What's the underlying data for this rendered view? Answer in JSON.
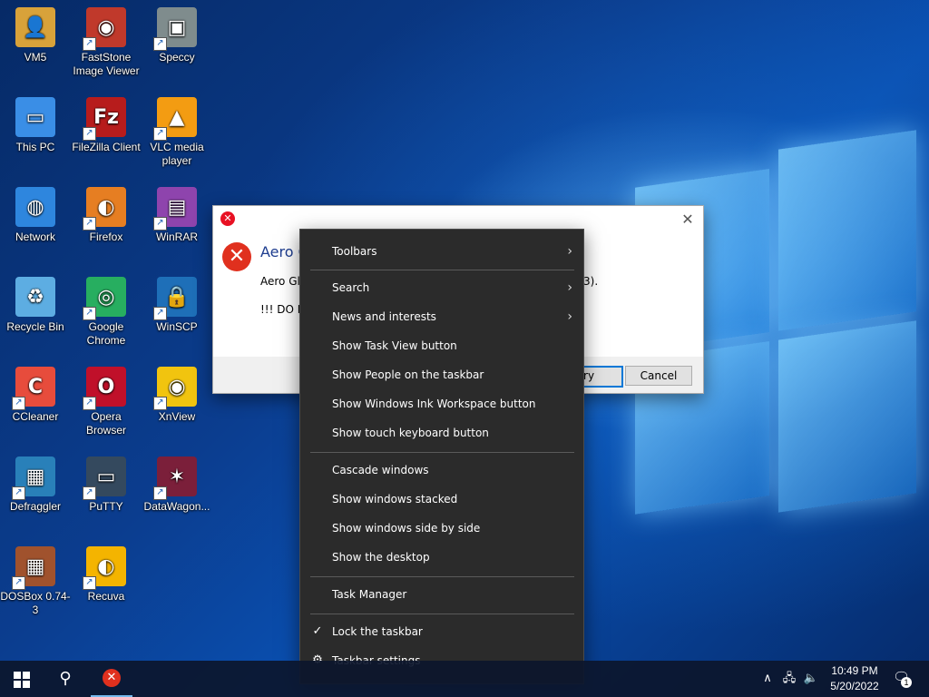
{
  "colors": {
    "menu_bg": "#2b2b2b",
    "taskbar_bg": "#0c162c",
    "error_red": "#e0301e",
    "dialog_heading": "#1e3d8f",
    "accent": "#0078d7"
  },
  "desktop": {
    "icons": [
      {
        "label": "VM5",
        "icon": "user-folder-icon"
      },
      {
        "label": "FastStone Image Viewer",
        "icon": "faststone-eye-icon"
      },
      {
        "label": "Speccy",
        "icon": "speccy-icon"
      },
      {
        "label": "This PC",
        "icon": "computer-monitor-icon"
      },
      {
        "label": "FileZilla Client",
        "icon": "filezilla-icon"
      },
      {
        "label": "VLC media player",
        "icon": "vlc-cone-icon"
      },
      {
        "label": "Network",
        "icon": "network-globe-icon"
      },
      {
        "label": "Firefox",
        "icon": "firefox-icon"
      },
      {
        "label": "WinRAR",
        "icon": "winrar-books-icon"
      },
      {
        "label": "Recycle Bin",
        "icon": "recycle-bin-icon"
      },
      {
        "label": "Google Chrome",
        "icon": "chrome-icon"
      },
      {
        "label": "WinSCP",
        "icon": "winscp-lock-icon"
      },
      {
        "label": "CCleaner",
        "icon": "ccleaner-icon"
      },
      {
        "label": "Opera Browser",
        "icon": "opera-icon"
      },
      {
        "label": "XnView",
        "icon": "xnview-eye-icon"
      },
      {
        "label": "Defraggler",
        "icon": "defraggler-cubes-icon"
      },
      {
        "label": "PuTTY",
        "icon": "putty-terminals-icon"
      },
      {
        "label": "DataWagon...",
        "icon": "datawagon-star-icon"
      },
      {
        "label": "DOSBox 0.74-3",
        "icon": "dosbox-crate-icon"
      },
      {
        "label": "Recuva",
        "icon": "recuva-icon"
      }
    ]
  },
  "dialog": {
    "title_icon": "error-icon",
    "heading": "Aero G",
    "message_line1_start": "Aero Gla",
    "message_line1_end": "3).",
    "message_line2": "!!! DO NO",
    "retry_label": "etry",
    "cancel_label": "Cancel",
    "close_glyph": "✕"
  },
  "context_menu": {
    "items": [
      {
        "label": "Toolbars",
        "arrow": "›"
      },
      {
        "label": "Search",
        "arrow": "›"
      },
      {
        "label": "News and interests",
        "arrow": "›"
      },
      {
        "label": "Show Task View button"
      },
      {
        "label": "Show People on the taskbar"
      },
      {
        "label": "Show Windows Ink Workspace button"
      },
      {
        "label": "Show touch keyboard button"
      },
      {
        "label": "Cascade windows"
      },
      {
        "label": "Show windows stacked"
      },
      {
        "label": "Show windows side by side"
      },
      {
        "label": "Show the desktop"
      },
      {
        "label": "Task Manager"
      },
      {
        "label": "Lock the taskbar",
        "lead": "✓"
      },
      {
        "label": "Taskbar settings",
        "lead": "⚙"
      }
    ]
  },
  "taskbar": {
    "search_glyph": "⚲",
    "tray_chevron": "∧",
    "tray_network": "🖧",
    "tray_volume": "🔈",
    "time": "10:49 PM",
    "date": "5/20/2022",
    "notification_count": "1",
    "notification_glyph": "🗨"
  }
}
